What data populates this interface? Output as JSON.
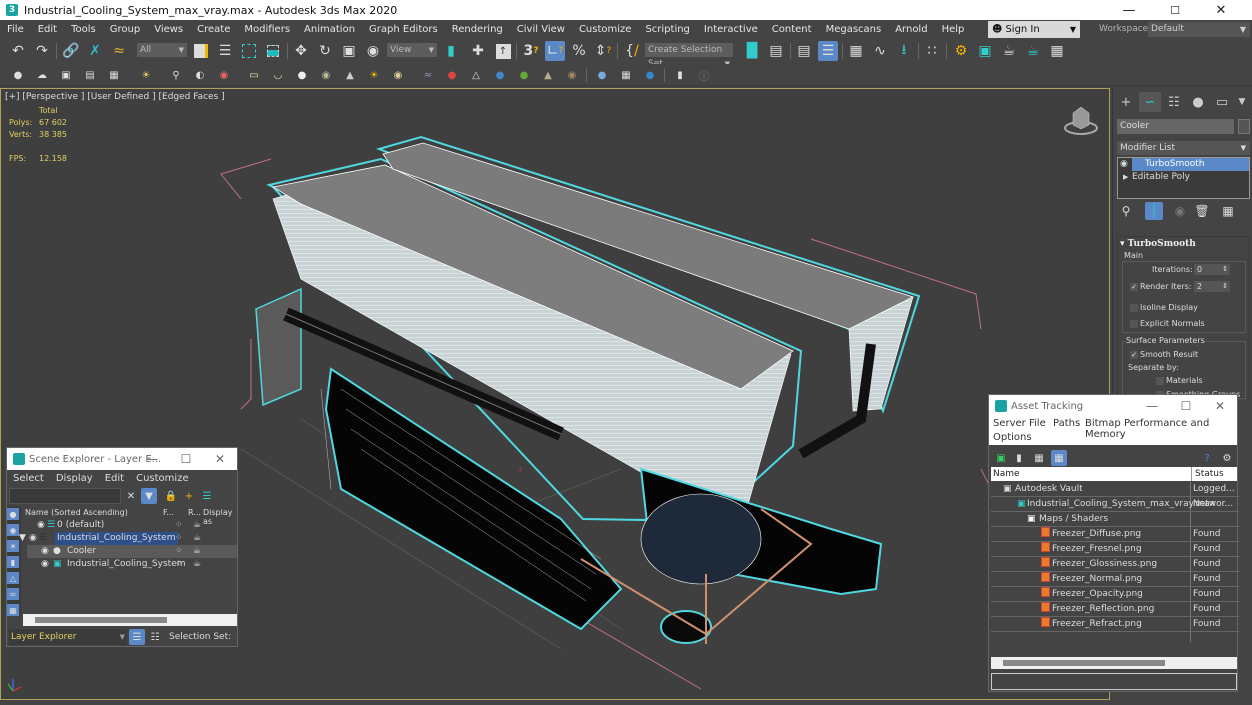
{
  "window": {
    "title": "Industrial_Cooling_System_max_vray.max - Autodesk 3ds Max 2020",
    "controls": [
      "minimize",
      "maximize",
      "close"
    ]
  },
  "menubar": {
    "items": [
      "File",
      "Edit",
      "Tools",
      "Group",
      "Views",
      "Create",
      "Modifiers",
      "Animation",
      "Graph Editors",
      "Rendering",
      "Civil View",
      "Customize",
      "Scripting",
      "Interactive",
      "Content",
      "Megascans",
      "Arnold",
      "Help"
    ],
    "sign_in": "Sign In",
    "workspaces_label": "Workspaces:",
    "workspace_value": "Default"
  },
  "toolbar": {
    "selection_filter": "All",
    "reference_coord": "View",
    "named_selection_set": "Create Selection Set"
  },
  "viewport": {
    "label": "[+] [Perspective ] [User Defined ] [Edged Faces ]",
    "stats_header": "Total",
    "polys_label": "Polys:",
    "polys_value": "67 602",
    "verts_label": "Verts:",
    "verts_value": "38 385",
    "fps_label": "FPS:",
    "fps_value": "12.158",
    "axis_labels": [
      "z",
      "y",
      "x"
    ]
  },
  "command_panel": {
    "object_name": "Cooler",
    "modifier_list": "Modifier List",
    "stack": [
      "TurboSmooth",
      "Editable Poly"
    ],
    "selected_modifier": "TurboSmooth",
    "rollout_title": "TurboSmooth",
    "main_group": "Main",
    "iterations_label": "Iterations:",
    "iterations_value": "0",
    "render_iters_label": "Render Iters:",
    "render_iters_value": "2",
    "render_iters_checked": true,
    "isoline_display": "Isoline Display",
    "explicit_normals": "Explicit Normals",
    "surface_group": "Surface Parameters",
    "smooth_result": "Smooth Result",
    "smooth_result_checked": true,
    "separate_by": "Separate by:",
    "materials": "Materials",
    "smoothing_groups": "Smoothing Groups"
  },
  "scene_explorer": {
    "title": "Scene Explorer - Layer E...",
    "menu": [
      "Select",
      "Display",
      "Edit",
      "Customize"
    ],
    "columns": [
      "Name (Sorted Ascending)",
      "F...",
      "R...",
      "Display as"
    ],
    "rows": [
      {
        "name": "0 (default)",
        "level": 0,
        "type": "layer"
      },
      {
        "name": "Industrial_Cooling_System",
        "level": 0,
        "type": "layer",
        "selected": true,
        "expanded": true
      },
      {
        "name": "Cooler",
        "level": 1,
        "type": "object",
        "highlight": true
      },
      {
        "name": "Industrial_Cooling_System",
        "level": 1,
        "type": "group"
      }
    ],
    "footer_mode": "Layer Explorer",
    "selection_set_label": "Selection Set:"
  },
  "asset_tracking": {
    "title": "Asset Tracking",
    "menu": [
      "Server",
      "File",
      "Paths",
      "Bitmap Performance and Memory",
      "Options"
    ],
    "columns": [
      "Name",
      "Status"
    ],
    "rows": [
      {
        "name": "Autodesk Vault",
        "status": "Logged...",
        "level": 0
      },
      {
        "name": "Industrial_Cooling_System_max_vray.max",
        "status": "Networ...",
        "level": 1
      },
      {
        "name": "Maps / Shaders",
        "status": "",
        "level": 2
      },
      {
        "name": "Freezer_Diffuse.png",
        "status": "Found",
        "level": 3
      },
      {
        "name": "Freezer_Fresnel.png",
        "status": "Found",
        "level": 3
      },
      {
        "name": "Freezer_Glossiness.png",
        "status": "Found",
        "level": 3
      },
      {
        "name": "Freezer_Normal.png",
        "status": "Found",
        "level": 3
      },
      {
        "name": "Freezer_Opacity.png",
        "status": "Found",
        "level": 3
      },
      {
        "name": "Freezer_Reflection.png",
        "status": "Found",
        "level": 3
      },
      {
        "name": "Freezer_Refract.png",
        "status": "Found",
        "level": 3
      }
    ]
  },
  "colors": {
    "accent": "#5b88c7",
    "selection_outline": "#4fd8e0",
    "stats_text": "#e0d060",
    "viewport_border": "#b3a15b",
    "teal_icon": "#1ba3a3"
  }
}
